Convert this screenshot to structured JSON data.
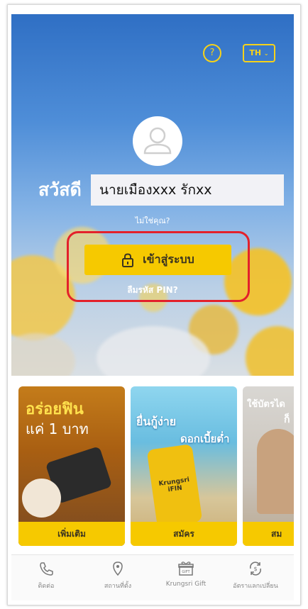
{
  "header": {
    "help_icon": "question-icon",
    "lang_label": "TH"
  },
  "login": {
    "greeting": "สวัสดี",
    "user_name": "นายเมืองxxx รักxx",
    "not_you": "ไม่ใช่คุณ?",
    "login_label": "เข้าสู่ระบบ",
    "forgot_pin": "ลืมรหัส PIN?",
    "highlight_color": "#e3212b"
  },
  "promos": [
    {
      "headline1": "อร่อยฟิน",
      "headline2": "แค่ 1 บาท",
      "button": "เพิ่มเติม"
    },
    {
      "headline1": "ยื่นกู้ง่าย",
      "headline2": "ดอกเบี้ยต่ำ",
      "phone_text": "Krungsri iFIN",
      "button": "สมัคร"
    },
    {
      "headline1": "ใช้บัตรได",
      "headline2": "ก็",
      "button": "สม"
    }
  ],
  "nav": [
    {
      "label": "ติดต่อ",
      "icon": "phone-icon"
    },
    {
      "label": "สถานที่ตั้ง",
      "icon": "location-pin-icon"
    },
    {
      "label": "Krungsri Gift",
      "icon": "gift-icon"
    },
    {
      "label": "อัตราแลกเปลี่ยน",
      "icon": "exchange-icon"
    }
  ],
  "colors": {
    "accent": "#f6c900",
    "accent_text": "#3b3420"
  }
}
